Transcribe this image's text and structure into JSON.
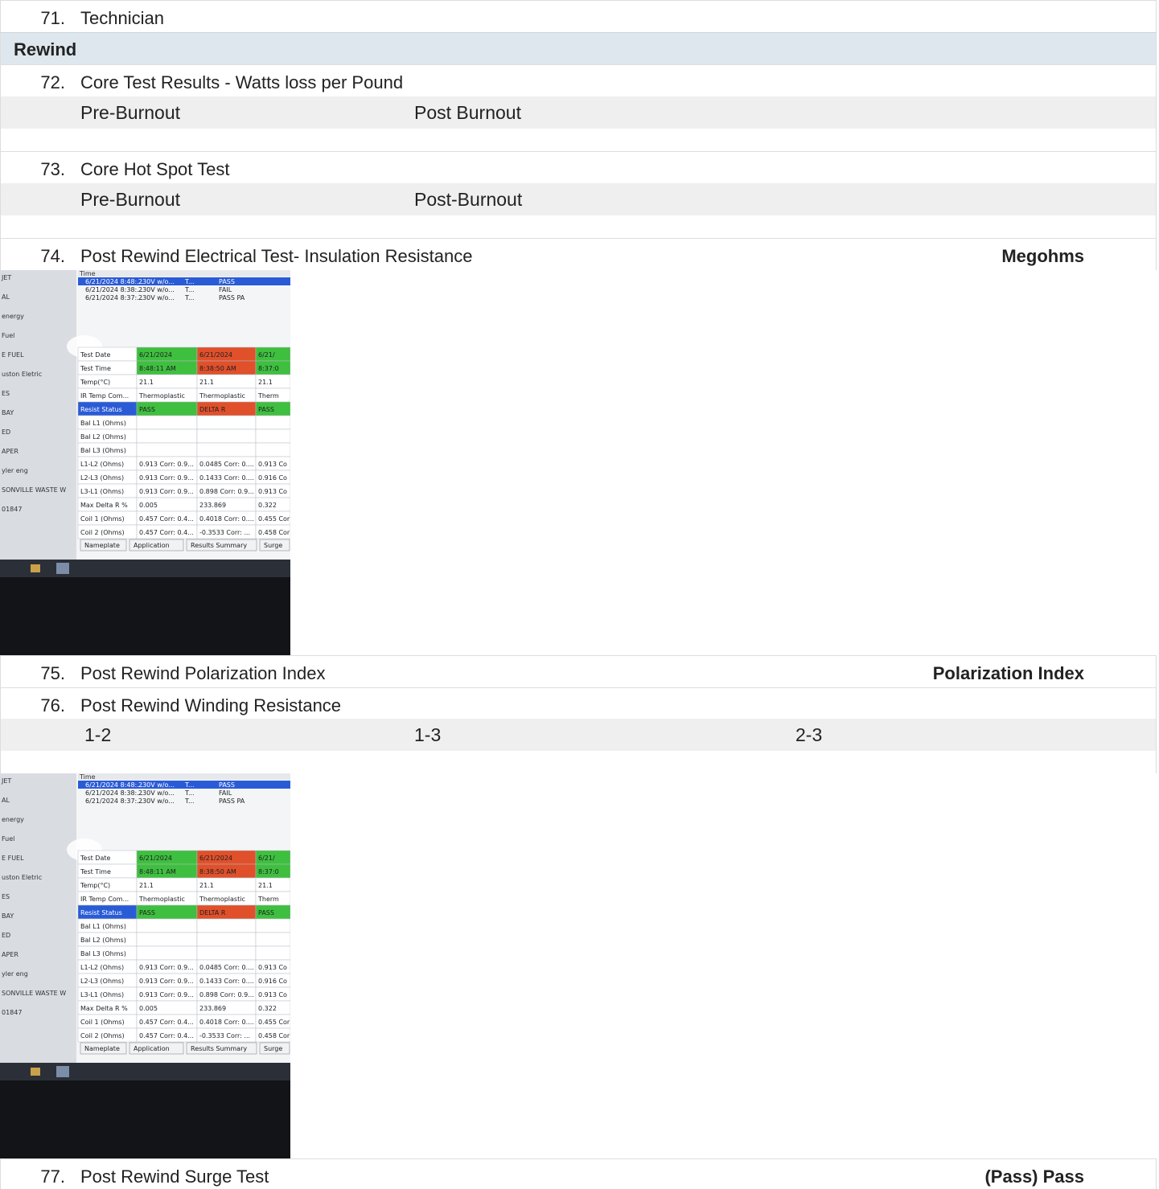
{
  "items": {
    "q71": {
      "num": "71.",
      "text": "Technician"
    },
    "section": "Rewind",
    "q72": {
      "num": "72.",
      "text": "Core Test Results - Watts loss per Pound",
      "pre": "Pre-Burnout",
      "post": "Post Burnout"
    },
    "q73": {
      "num": "73.",
      "text": "Core Hot Spot Test",
      "pre": "Pre-Burnout",
      "post": "Post-Burnout"
    },
    "q74": {
      "num": "74.",
      "text": "Post Rewind Electrical Test- Insulation Resistance",
      "right": "Megohms"
    },
    "q75": {
      "num": "75.",
      "text": "Post Rewind Polarization Index",
      "right": "Polarization Index"
    },
    "q76": {
      "num": "76.",
      "text": "Post Rewind Winding Resistance",
      "c1": "1-2",
      "c2": "1-3",
      "c3": "2-3"
    },
    "q77": {
      "num": "77.",
      "text": "Post Rewind Surge Test",
      "right": "(Pass) Pass"
    }
  },
  "photo": {
    "history": [
      {
        "time": "6/21/2024 8:48:...",
        "id": "230V w/o...",
        "t": "T...",
        "res": "PASS"
      },
      {
        "time": "6/21/2024 8:38:...",
        "id": "230V w/o...",
        "t": "T...",
        "res": "FAIL"
      },
      {
        "time": "6/21/2024 8:37:...",
        "id": "230V w/o...",
        "t": "T...",
        "res": "PASS PA"
      }
    ],
    "table": [
      [
        "Test Date",
        "6/21/2024",
        "6/21/2024",
        "6/21/"
      ],
      [
        "Test Time",
        "8:48:11 AM",
        "8:38:50 AM",
        "8:37:0"
      ],
      [
        "Temp(°C)",
        "21.1",
        "21.1",
        "21.1"
      ],
      [
        "IR Temp Com...",
        "Thermoplastic",
        "Thermoplastic",
        "Therm"
      ],
      [
        "Resist Status",
        "PASS",
        "DELTA R",
        "PASS"
      ],
      [
        "Bal L1 (Ohms)",
        "",
        "",
        ""
      ],
      [
        "Bal L2 (Ohms)",
        "",
        "",
        ""
      ],
      [
        "Bal L3 (Ohms)",
        "",
        "",
        ""
      ],
      [
        "L1-L2 (Ohms)",
        "0.913 Corr: 0.9...",
        "0.0485 Corr: 0....",
        "0.913 Co"
      ],
      [
        "L2-L3 (Ohms)",
        "0.913 Corr: 0.9...",
        "0.1433 Corr: 0....",
        "0.916 Co"
      ],
      [
        "L3-L1 (Ohms)",
        "0.913 Corr: 0.9...",
        "0.898 Corr: 0.9...",
        "0.913 Co"
      ],
      [
        "Max Delta R %",
        "0.005",
        "233.869",
        "0.322"
      ],
      [
        "Coil 1 (Ohms)",
        "0.457 Corr: 0.4...",
        "0.4018 Corr: 0....",
        "0.455 Cor"
      ],
      [
        "Coil 2 (Ohms)",
        "0.457 Corr: 0.4...",
        "-0.3533 Corr: ...",
        "0.458 Cor"
      ]
    ],
    "tabs": [
      "Nameplate",
      "Application",
      "Results Summary",
      "Surge"
    ],
    "sidebar": [
      "JET",
      "AL",
      "energy",
      "Fuel",
      "E FUEL",
      "uston Eletric",
      "ES",
      "BAY",
      "ED",
      "APER",
      "yler eng",
      "SONVILLE WASTE W",
      "01847"
    ]
  },
  "colors": {
    "section_bg": "#dfe7ee",
    "sub_bg": "#efefef",
    "pass": "#3fbf3f",
    "fail": "#e0502a",
    "select": "#2a5bd7"
  }
}
